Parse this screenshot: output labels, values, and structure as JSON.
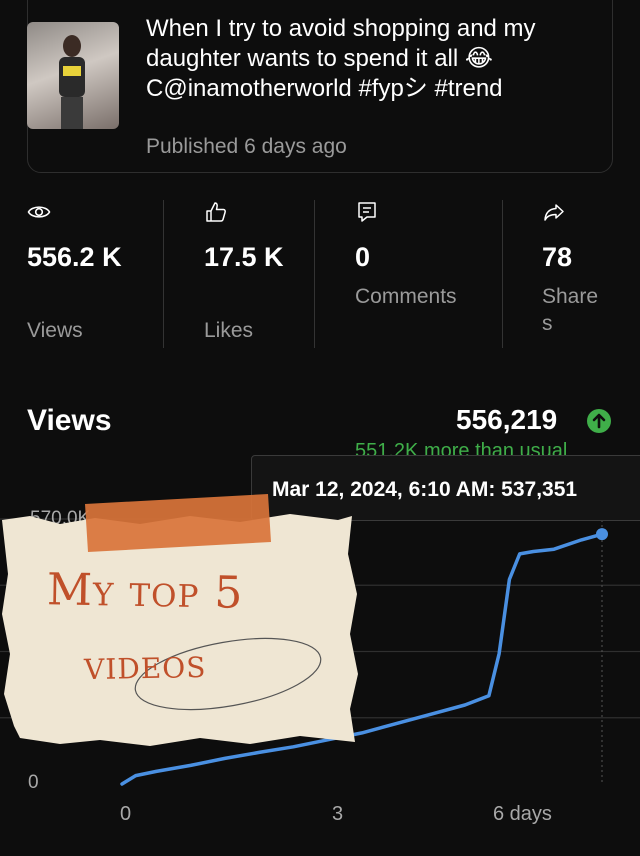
{
  "video": {
    "title": "When I try to avoid shopping and my daughter wants to spend it all 😂 C@inamotherworld #fypシ #trend",
    "published": "Published 6 days ago"
  },
  "stats": [
    {
      "icon": "eye-icon",
      "number": "556.2 K",
      "label": "Views"
    },
    {
      "icon": "thumbs-up-icon",
      "number": "17.5 K",
      "label": "Likes"
    },
    {
      "icon": "comment-icon",
      "number": "0",
      "label": "Comments"
    },
    {
      "icon": "share-icon",
      "number": "78",
      "label": "Shares"
    }
  ],
  "views_section": {
    "title": "Views",
    "total": "556,219",
    "comparison": "551.2K more than usual",
    "tooltip": "Mar 12, 2024, 6:10 AM: 537,351"
  },
  "sticker": {
    "line1": "My top 5",
    "line2": "videos"
  },
  "colors": {
    "accent_green": "#3fae49",
    "line_blue": "#4a90e2",
    "sticker_paper": "#efe6d3",
    "sticker_tape": "#d9743a",
    "sticker_text": "#c0502a"
  },
  "chart_data": {
    "type": "line",
    "title": "Views",
    "xlabel": "",
    "ylabel": "",
    "x_ticks": [
      "0",
      "3",
      "6 days"
    ],
    "y_ticks": [
      "0",
      "570.0K"
    ],
    "ylim": [
      0,
      570000
    ],
    "xlim": [
      0,
      7
    ],
    "grid": true,
    "series": [
      {
        "x": [
          0,
          0.2,
          0.5,
          1.0,
          1.5,
          2.0,
          2.5,
          3.0,
          3.5,
          4.0,
          4.5,
          5.0,
          5.35,
          5.5,
          5.65,
          5.8,
          6.0,
          6.3,
          6.7,
          7.0
        ],
        "y": [
          0,
          18000,
          27000,
          40000,
          55000,
          68000,
          80000,
          95000,
          110000,
          130000,
          150000,
          170000,
          190000,
          280000,
          440000,
          495000,
          500000,
          505000,
          525000,
          537351
        ]
      }
    ],
    "tooltip_point": {
      "x": 7.0,
      "y": 537351
    }
  }
}
